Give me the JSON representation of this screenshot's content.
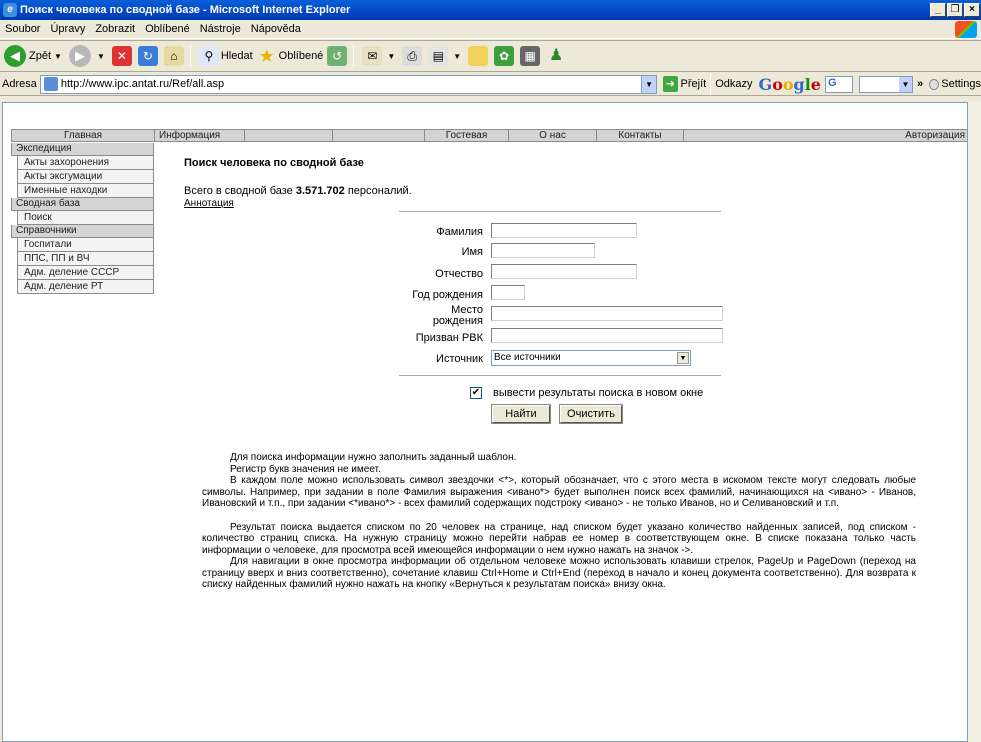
{
  "window": {
    "title": "Поиск человека по сводной базе - Microsoft Internet Explorer",
    "controls": [
      "_",
      "❐",
      "×"
    ]
  },
  "menu": [
    "Soubor",
    "Úpravy",
    "Zobrazit",
    "Oblíbené",
    "Nástroje",
    "Nápověda"
  ],
  "toolbar": {
    "back": "Zpět",
    "search": "Hledat",
    "favorites": "Oblíbené"
  },
  "address": {
    "label": "Adresa",
    "url": "http://www.ipc.antat.ru/Ref/all.asp",
    "go": "Přejít",
    "links": "Odkazy",
    "google_g": "G",
    "google_o1": "o",
    "google_o2": "o",
    "google_g2": "g",
    "google_l": "l",
    "google_e": "e",
    "google_box": "G",
    "chevron": "»",
    "settings": "Settings"
  },
  "nav": [
    "Главная",
    "Информация",
    "",
    "",
    "Гостевая",
    "О нас",
    "Контакты",
    "Авторизация"
  ],
  "sidebar": {
    "sections": [
      {
        "title": "Экспедиция",
        "items": [
          "Акты захоронения",
          "Акты эксгумации",
          "Именные находки"
        ]
      },
      {
        "title": "Сводная база",
        "items": [
          "Поиск"
        ]
      },
      {
        "title": "Справочники",
        "items": [
          "Госпитали",
          "ППС, ПП и ВЧ",
          "Адм. деление СССР",
          "Адм. деление РТ"
        ]
      }
    ]
  },
  "main": {
    "heading": "Поиск человека по сводной базе",
    "total_prefix": "Всего в сводной базе ",
    "total_value": "3.571.702",
    "total_suffix": " персоналий.",
    "annotation_link": "Аннотация"
  },
  "form": {
    "surname_label": "Фамилия",
    "name_label": "Имя",
    "patronymic_label": "Отчество",
    "birth_year_label": "Год рождения",
    "birth_place_label_1": "Место",
    "birth_place_label_2": "рождения",
    "draft_label": "Призван РВК",
    "source_label": "Источник",
    "source_value": "Все источники",
    "new_window_checked": true,
    "new_window_label": "вывести результаты поиска в новом окне",
    "find_button": "Найти",
    "clear_button": "Очистить"
  },
  "help": {
    "p1": "Для поиска информации нужно заполнить заданный шаблон.",
    "p2": "Регистр букв значения не имеет.",
    "p3": "В каждом поле можно использовать символ звездочки <*>, который обозначает, что с этого места в искомом тексте могут следовать любые символы. Например, при задании в поле Фамилия выражения <ивано*> будет выполнен поиск всех фамилий, начинающихся на <ивано> - Иванов, Ивановский и т.п., при задании <*ивано*> - всех фамилий содержащих подстроку <ивано> - не только Иванов, но и Селивановский и т.п.",
    "p4": "Результат поиска выдается списком по 20 человек на странице, над списком будет указано количество найденных записей, под списком - количество страниц списка. На нужную страницу можно перейти набрав ее номер в соответствующем окне. В списке показана только часть информации о человеке, для просмотра всей имеющейся информации о нем нужно нажать на значок ->.",
    "p5": "Для навигации в окне просмотра информации об отдельном человеке можно использовать клавиши стрелок, PageUp и PageDown (переход на страницу вверх и вниз соответственно), сочетание клавиш Ctrl+Home и Ctrl+End (переход в начало и конец документа соответственно). Для возврата к списку найденных фамилий нужно нажать на кнопку «Вернуться к результатам поиска» внизу окна."
  }
}
